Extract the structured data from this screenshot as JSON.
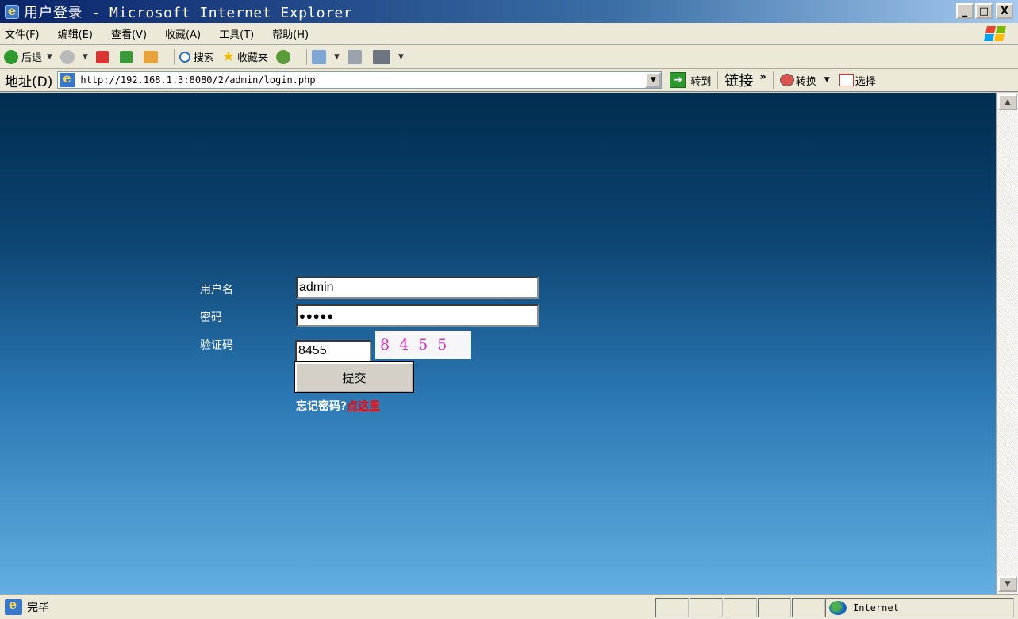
{
  "window": {
    "title": "用户登录 - Microsoft Internet Explorer",
    "controls": {
      "minimize": "_",
      "maximize": "□",
      "close": "X"
    }
  },
  "menubar": {
    "items": [
      "文件(F)",
      "编辑(E)",
      "查看(V)",
      "收藏(A)",
      "工具(T)",
      "帮助(H)"
    ]
  },
  "toolbar": {
    "back": "后退",
    "search": "搜索",
    "favorites": "收藏夹"
  },
  "addressbar": {
    "label": "地址(D)",
    "url": "http://192.168.1.3:8080/2/admin/login.php",
    "go": "转到",
    "links": "链接",
    "more": "»",
    "convert": "转换",
    "select": "选择"
  },
  "login": {
    "username_label": "用户名",
    "username_value": "admin",
    "password_label": "密码",
    "password_value": "●●●●●",
    "captcha_label": "验证码",
    "captcha_value": "8455",
    "captcha_image_text": "8455",
    "submit_label": "提交",
    "forgot_text": "忘记密码?",
    "forgot_link": "点这里"
  },
  "statusbar": {
    "status": "完毕",
    "zone": "Internet"
  },
  "colors": {
    "title_gradient_start": "#0a246a",
    "page_bg_top": "#002d4f",
    "page_bg_bottom": "#63aee0",
    "captcha_text": "#d431c0",
    "link_red": "#ff0000"
  }
}
